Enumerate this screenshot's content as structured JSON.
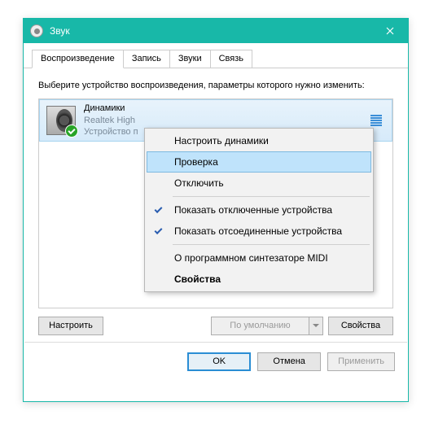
{
  "window": {
    "title": "Звук"
  },
  "tabs": [
    {
      "label": "Воспроизведение"
    },
    {
      "label": "Запись"
    },
    {
      "label": "Звуки"
    },
    {
      "label": "Связь"
    }
  ],
  "instruction": "Выберите устройство воспроизведения, параметры которого нужно изменить:",
  "device": {
    "name": "Динамики",
    "mfr": "Realtek High",
    "status": "Устройство п"
  },
  "context_menu": [
    {
      "label": "Настроить динамики",
      "type": "item"
    },
    {
      "label": "Проверка",
      "type": "hover"
    },
    {
      "label": "Отключить",
      "type": "item"
    },
    {
      "type": "sep"
    },
    {
      "label": "Показать отключенные устройства",
      "type": "check"
    },
    {
      "label": "Показать отсоединенные устройства",
      "type": "check"
    },
    {
      "type": "sep"
    },
    {
      "label": "О программном синтезаторе MIDI",
      "type": "item"
    },
    {
      "label": "Свойства",
      "type": "bold"
    }
  ],
  "panel_buttons": {
    "configure": "Настроить",
    "default": "По умолчанию",
    "props": "Свойства"
  },
  "footer": {
    "ok": "OK",
    "cancel": "Отмена",
    "apply": "Применить"
  }
}
